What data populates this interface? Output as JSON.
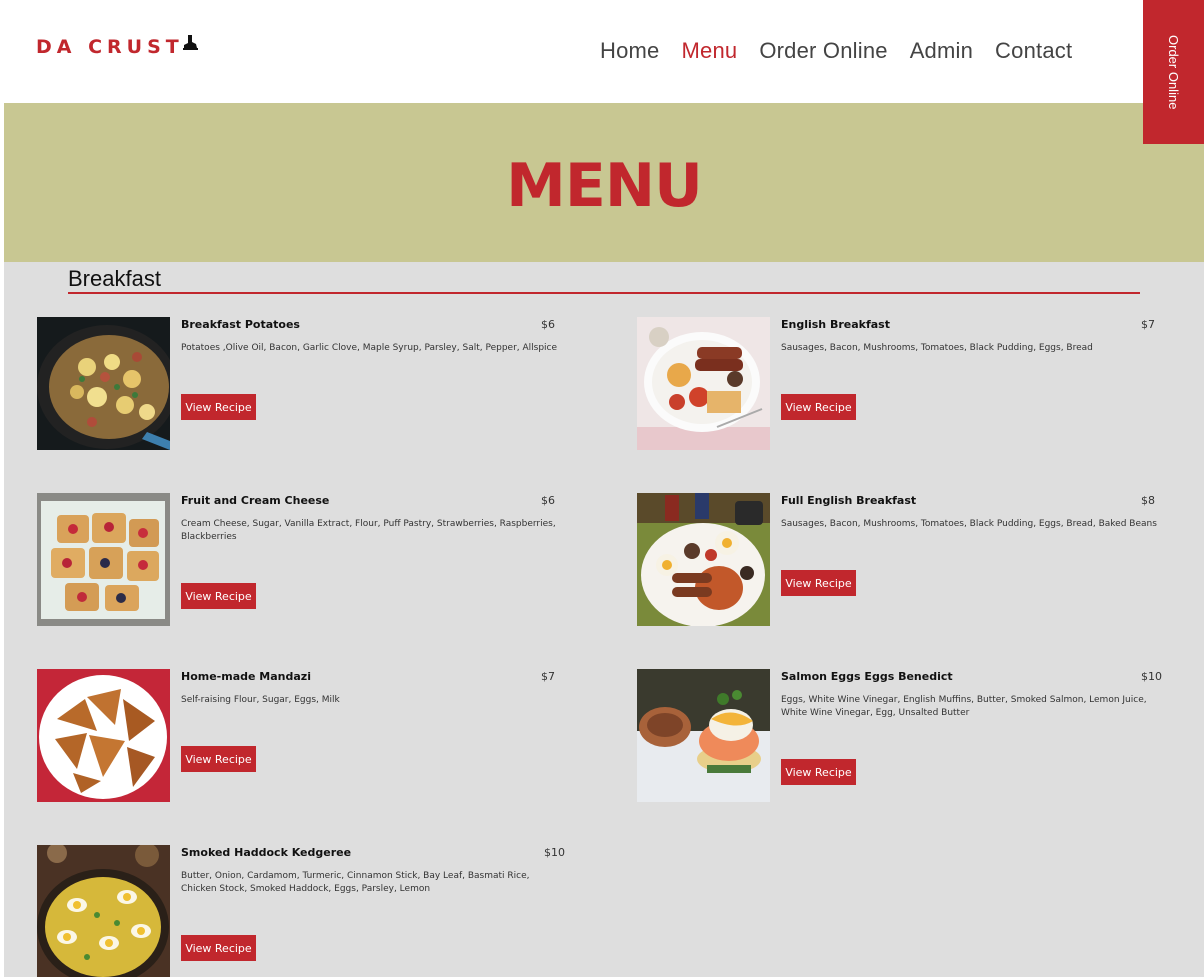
{
  "header": {
    "logo": "DA CRUST",
    "nav": [
      "Home",
      "Menu",
      "Order Online",
      "Admin",
      "Contact"
    ],
    "active_nav": "Menu",
    "order_tab": "Order Online"
  },
  "hero": {
    "title": "MENU"
  },
  "section": {
    "title": "Breakfast"
  },
  "button_label": "View Recipe",
  "items": [
    {
      "name": "Breakfast Potatoes",
      "price": "$6",
      "desc": "Potatoes ,Olive Oil, Bacon, Garlic Clove, Maple Syrup, Parsley, Salt, Pepper, Allspice"
    },
    {
      "name": "English Breakfast",
      "price": "$7",
      "desc": "Sausages, Bacon, Mushrooms, Tomatoes, Black Pudding, Eggs, Bread"
    },
    {
      "name": "Fruit and Cream Cheese",
      "price": "$6",
      "desc": "Cream Cheese, Sugar, Vanilla Extract, Flour, Puff Pastry, Strawberries, Raspberries, Blackberries"
    },
    {
      "name": "Full English Breakfast",
      "price": "$8",
      "desc": "Sausages, Bacon, Mushrooms, Tomatoes, Black Pudding, Eggs, Bread, Baked Beans"
    },
    {
      "name": "Home-made Mandazi",
      "price": "$7",
      "desc": "Self-raising Flour, Sugar, Eggs, Milk"
    },
    {
      "name": "Salmon Eggs Eggs Benedict",
      "price": "$10",
      "desc": "Eggs, White Wine Vinegar, English Muffins, Butter, Smoked Salmon, Lemon Juice, White Wine Vinegar, Egg, Unsalted Butter"
    },
    {
      "name": "Smoked Haddock Kedgeree",
      "price": "$10",
      "desc": "Butter, Onion, Cardamom, Turmeric, Cinnamon Stick, Bay Leaf, Basmati Rice, Chicken Stock, Smoked Haddock, Eggs, Parsley, Lemon"
    }
  ]
}
